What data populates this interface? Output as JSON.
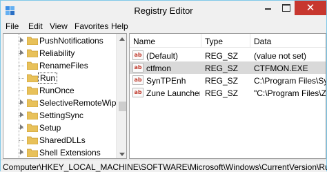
{
  "window": {
    "title": "Registry Editor"
  },
  "menu": [
    "File",
    "Edit",
    "View",
    "Favorites",
    "Help"
  ],
  "tree": {
    "items": [
      {
        "label": "PushNotifications",
        "expandable": true
      },
      {
        "label": "Reliability",
        "expandable": true
      },
      {
        "label": "RenameFiles",
        "expandable": false
      },
      {
        "label": "Run",
        "expandable": false,
        "selected": true
      },
      {
        "label": "RunOnce",
        "expandable": false
      },
      {
        "label": "SelectiveRemoteWipe",
        "expandable": true
      },
      {
        "label": "SettingSync",
        "expandable": true
      },
      {
        "label": "Setup",
        "expandable": true
      },
      {
        "label": "SharedDLLs",
        "expandable": false
      },
      {
        "label": "Shell Extensions",
        "expandable": true
      }
    ]
  },
  "list": {
    "columns": [
      "Name",
      "Type",
      "Data"
    ],
    "rows": [
      {
        "name": "(Default)",
        "type": "REG_SZ",
        "data": "(value not set)",
        "selected": false
      },
      {
        "name": "ctfmon",
        "type": "REG_SZ",
        "data": "CTFMON.EXE",
        "selected": true
      },
      {
        "name": "SynTPEnh",
        "type": "REG_SZ",
        "data": "C:\\Program Files\\Synaptics",
        "selected": false
      },
      {
        "name": "Zune Launcher",
        "type": "REG_SZ",
        "data": "\"C:\\Program Files\\Zune\\ZuneLauncher.exe\"",
        "selected": false
      }
    ]
  },
  "statusbar": {
    "path": "Computer\\HKEY_LOCAL_MACHINE\\SOFTWARE\\Microsoft\\Windows\\CurrentVersion\\Run"
  },
  "colors": {
    "close_button": "#c7372f",
    "selection": "#d9d9d9",
    "folder": "#e8c15a",
    "accent_border": "#7ec8e8"
  },
  "icons": {
    "app": "registry-icon",
    "value": "string-value-icon",
    "folder": "folder-icon"
  }
}
